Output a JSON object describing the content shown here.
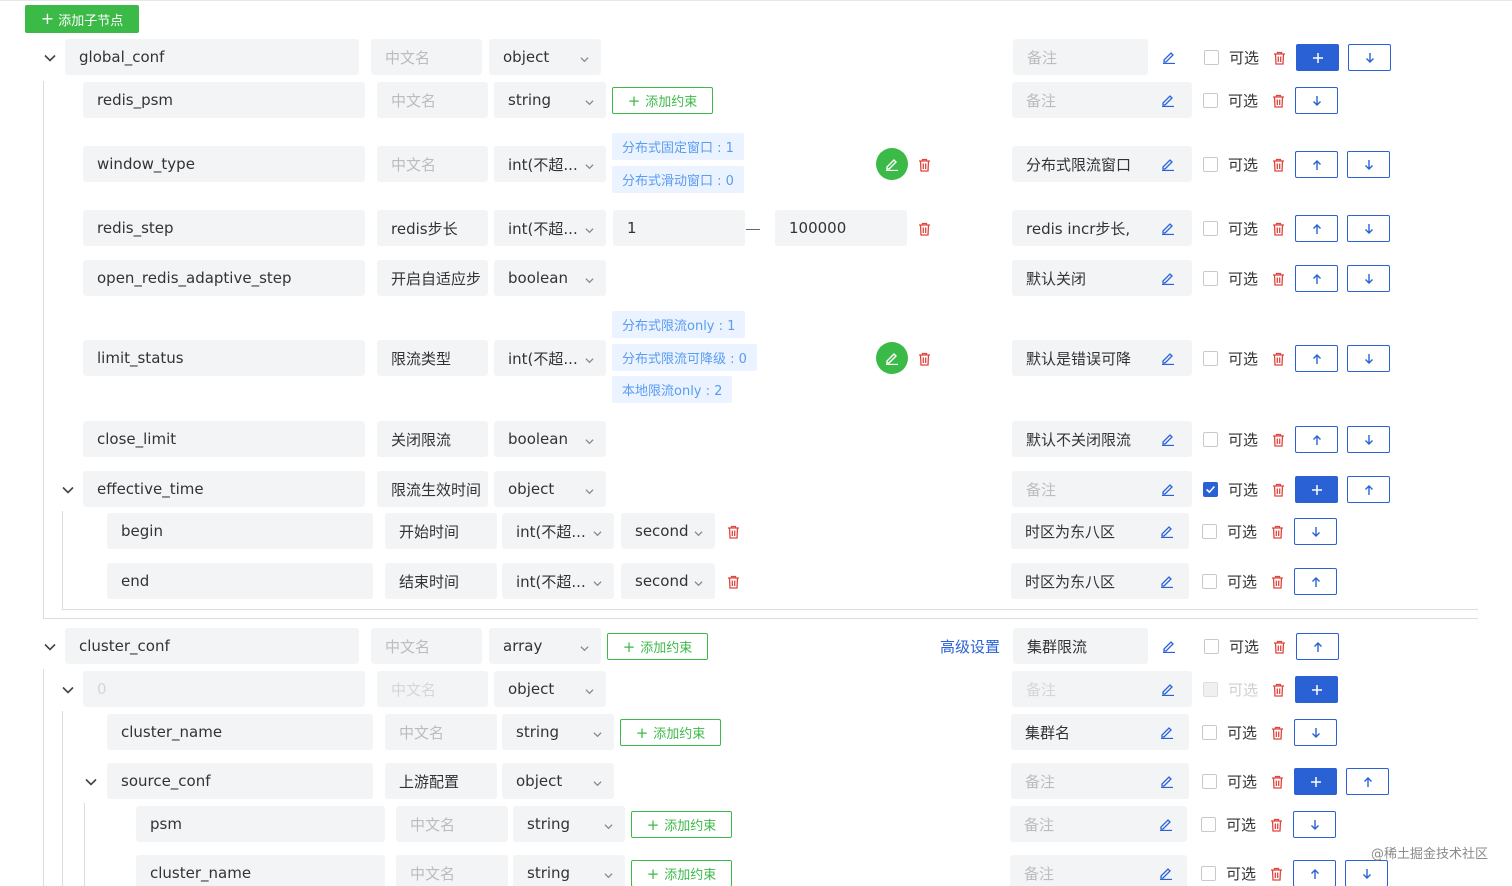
{
  "toolbar": {
    "add_child": "添加子节点"
  },
  "labels": {
    "optional": "可选",
    "add_constraint": "添加约束",
    "advanced": "高级设置",
    "dash": "—"
  },
  "rows": {
    "global_conf": {
      "name": "global_conf",
      "cn": "中文名",
      "type": "object",
      "remark": "备注",
      "optional_checked": false
    },
    "redis_psm": {
      "name": "redis_psm",
      "cn": "中文名",
      "type": "string",
      "remark": "备注"
    },
    "window_type": {
      "name": "window_type",
      "cn": "中文名",
      "type": "int(不超...",
      "remark": "分布式限流窗口",
      "enum": [
        "分布式固定窗口 : 1",
        "分布式滑动窗口 : 0"
      ]
    },
    "redis_step": {
      "name": "redis_step",
      "cn": "redis步长",
      "type": "int(不超...",
      "remark": "redis incr步长,",
      "min": "1",
      "max": "100000"
    },
    "open_redis_adaptive_step": {
      "name": "open_redis_adaptive_step",
      "cn": "开启自适应步",
      "type": "boolean",
      "remark": "默认关闭"
    },
    "limit_status": {
      "name": "limit_status",
      "cn": "限流类型",
      "type": "int(不超...",
      "remark": "默认是错误可降",
      "enum": [
        "分布式限流only : 1",
        "分布式限流可降级 : 0",
        "本地限流only : 2"
      ]
    },
    "close_limit": {
      "name": "close_limit",
      "cn": "关闭限流",
      "type": "boolean",
      "remark": "默认不关闭限流"
    },
    "effective_time": {
      "name": "effective_time",
      "cn": "限流生效时间",
      "type": "object",
      "remark": "备注",
      "optional_checked": true
    },
    "begin": {
      "name": "begin",
      "cn": "开始时间",
      "type": "int(不超...",
      "unit": "second",
      "remark": "时区为东八区"
    },
    "end": {
      "name": "end",
      "cn": "结束时间",
      "type": "int(不超...",
      "unit": "second",
      "remark": "时区为东八区"
    },
    "cluster_conf": {
      "name": "cluster_conf",
      "cn": "中文名",
      "type": "array",
      "remark": "集群限流"
    },
    "item0": {
      "name": "0",
      "cn": "中文名",
      "type": "object",
      "remark": "备注"
    },
    "cluster_name": {
      "name": "cluster_name",
      "cn": "中文名",
      "type": "string",
      "remark": "集群名"
    },
    "source_conf": {
      "name": "source_conf",
      "cn": "上游配置",
      "type": "object",
      "remark": "备注"
    },
    "psm": {
      "name": "psm",
      "cn": "中文名",
      "type": "string",
      "remark": "备注"
    },
    "cluster_name2": {
      "name": "cluster_name",
      "cn": "中文名",
      "type": "string",
      "remark": "备注"
    }
  },
  "watermark": "@稀土掘金技术社区",
  "icons": [
    "plus-icon",
    "chevron-down-icon",
    "caret-down-icon",
    "edit-icon",
    "trash-icon",
    "arrow-up-icon",
    "arrow-down-icon",
    "checkbox-icon"
  ],
  "colors": {
    "primary": "#2a62d6",
    "success": "#3cba48",
    "danger": "#e0443e",
    "tag_bg": "#eaf3ff",
    "field_bg": "#f3f4f6"
  }
}
